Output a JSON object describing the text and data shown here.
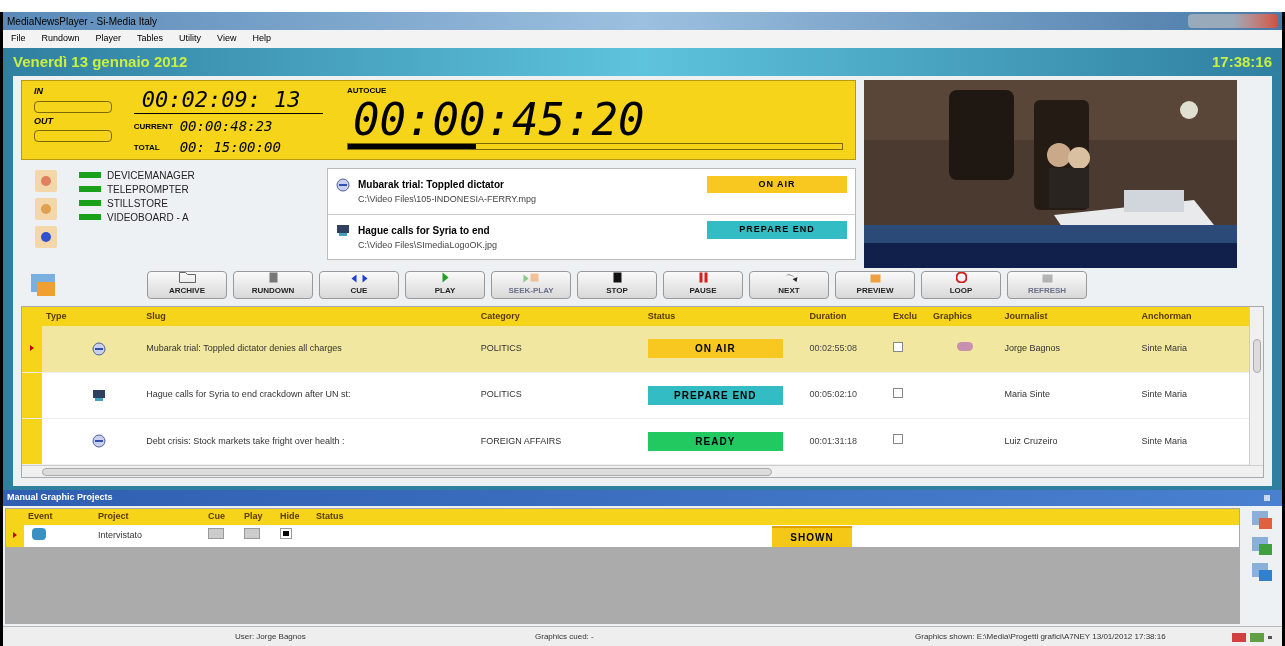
{
  "window": {
    "title": "MediaNewsPlayer - Si-Media Italy"
  },
  "menu": [
    "File",
    "Rundown",
    "Player",
    "Tables",
    "Utility",
    "View",
    "Help"
  ],
  "header": {
    "date": "Venerdì 13 gennaio 2012",
    "time": "17:38:16"
  },
  "timecodes": {
    "in_label": "IN",
    "out_label": "OUT",
    "main": "00:02:09: 13",
    "current_label": "CURRENT",
    "current": "00:00:48:23",
    "total_label": "TOTAL",
    "total": "00: 15:00:00",
    "autocue_label": "AUTOCUE",
    "countdown": "00:00:45:20",
    "level": 0.26
  },
  "devices": [
    {
      "name": "DEVICEMANAGER",
      "on": true
    },
    {
      "name": "TELEPROMPTER",
      "on": true
    },
    {
      "name": "STILLSTORE",
      "on": true
    },
    {
      "name": "VIDEOBOARD - A",
      "on": true
    }
  ],
  "now_playing": [
    {
      "kind": "clip",
      "title": "Mubarak trial: Toppled dictator",
      "path": "C:\\Video Files\\105-INDONESIA-FERRY.mpg",
      "status": "ON AIR",
      "color": "#f8c820"
    },
    {
      "kind": "still",
      "title": "Hague calls for Syria to end",
      "path": "C:\\Video Files\\SImediaLogoOK.jpg",
      "status": "PREPARE END",
      "color": "#34bcc4"
    }
  ],
  "toolbar": [
    {
      "label": "ARCHIVE",
      "disabled": false
    },
    {
      "label": "RUNDOWN",
      "disabled": false
    },
    {
      "label": "CUE",
      "disabled": false
    },
    {
      "label": "PLAY",
      "disabled": false
    },
    {
      "label": "SEEK-PLAY",
      "disabled": true
    },
    {
      "label": "STOP",
      "disabled": false
    },
    {
      "label": "PAUSE",
      "disabled": false
    },
    {
      "label": "NEXT",
      "disabled": false
    },
    {
      "label": "PREVIEW",
      "disabled": false
    },
    {
      "label": "LOOP",
      "disabled": false
    },
    {
      "label": "REFRESH",
      "disabled": true
    }
  ],
  "rundown": {
    "columns": [
      "Type",
      "Slug",
      "Category",
      "Status",
      "Duration",
      "Exclu",
      "Graphics",
      "Journalist",
      "Anchorman"
    ],
    "rows": [
      {
        "selected": true,
        "kind": "clip",
        "slug": "Mubarak trial: Toppled dictator denies all charges",
        "category": "POLITICS",
        "status": "ON AIR",
        "color": "#f8c820",
        "duration": "00:02:55:08",
        "exclusive": false,
        "graphics": true,
        "journalist": "Jorge Bagnos",
        "anchorman": "Sinte Maria"
      },
      {
        "selected": false,
        "kind": "still",
        "slug": "Hague calls for Syria to end crackdown after UN st:",
        "category": "POLITICS",
        "status": "PREPARE END",
        "color": "#34bcc4",
        "duration": "00:05:02:10",
        "exclusive": false,
        "graphics": false,
        "journalist": "Maria Sinte",
        "anchorman": "Sinte Maria"
      },
      {
        "selected": false,
        "kind": "clip",
        "slug": "Debt crisis: Stock markets take fright over health :",
        "category": "FOREIGN AFFAIRS",
        "status": "READY",
        "color": "#22c860",
        "duration": "00:01:31:18",
        "exclusive": false,
        "graphics": false,
        "journalist": "Luiz Cruzeiro",
        "anchorman": "Sinte Maria"
      }
    ]
  },
  "manual_graphics": {
    "title": "Manual Graphic Projects",
    "columns": [
      "Event",
      "Project",
      "Cue",
      "Play",
      "Hide",
      "Status"
    ],
    "rows": [
      {
        "selected": true,
        "project": "Intervistato",
        "status": "SHOWN"
      }
    ]
  },
  "status_bar": {
    "user": "User: Jorge Bagnos",
    "cued": "Graphics cued: -",
    "shown": "Graphics shown: E:\\Media\\Progetti grafici\\A7NEY 13/01/2012 17:38:16"
  }
}
